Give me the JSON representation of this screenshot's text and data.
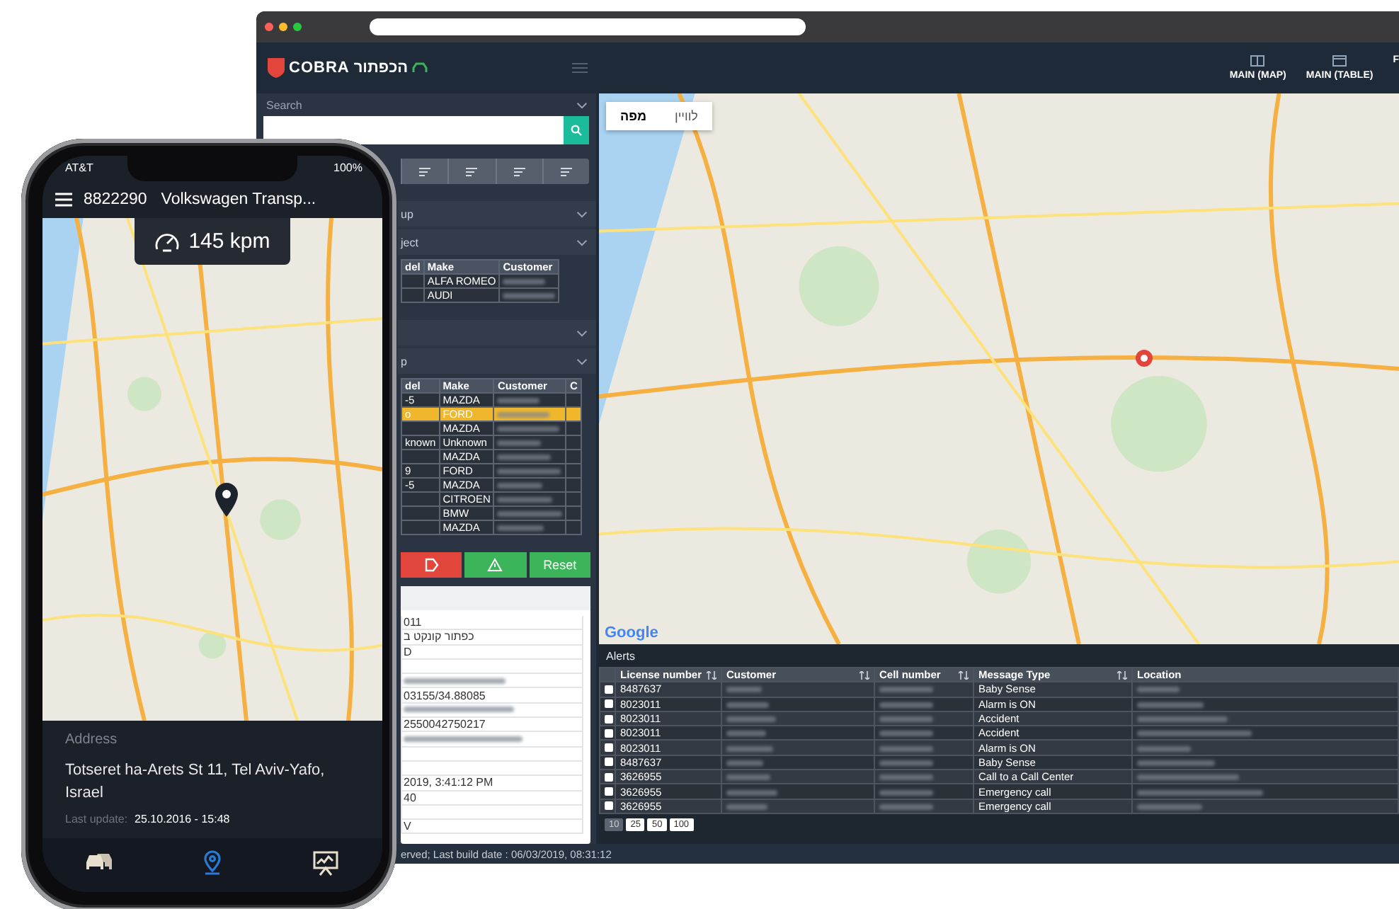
{
  "browser": {
    "logo": {
      "latin": "COBRA",
      "hebrew": "הכפתור"
    },
    "nav": [
      {
        "label": "MAIN (MAP)",
        "kind": "columns"
      },
      {
        "label": "MAIN (TABLE)",
        "kind": "window"
      },
      {
        "label": "F",
        "kind": "cut"
      }
    ],
    "sidebar": {
      "search_label": "Search",
      "sections": [
        {
          "kind": "group",
          "title": "up"
        },
        {
          "kind": "group",
          "title": "ject",
          "table": {
            "columns": [
              "del",
              "Make",
              "Customer"
            ],
            "rows": [
              {
                "make": "ALFA ROMEO",
                "selected": false
              },
              {
                "make": "AUDI",
                "selected": false
              }
            ]
          }
        },
        {
          "kind": "group"
        },
        {
          "kind": "group",
          "title": "p",
          "table": {
            "columns": [
              "del",
              "Make",
              "Customer",
              "C"
            ],
            "rows": [
              {
                "model": "-5",
                "make": "MAZDA",
                "selected": false
              },
              {
                "model": "o",
                "make": "FORD",
                "selected": true
              },
              {
                "make": "MAZDA",
                "selected": false
              },
              {
                "model": "known",
                "make": "Unknown",
                "selected": false
              },
              {
                "make": "MAZDA",
                "selected": false
              },
              {
                "model": "9",
                "make": "FORD",
                "selected": false
              },
              {
                "model": "-5",
                "make": "MAZDA",
                "selected": false
              },
              {
                "make": "CITROEN",
                "selected": false
              },
              {
                "make": "BMW",
                "selected": false
              },
              {
                "make": "MAZDA",
                "selected": false
              }
            ]
          }
        }
      ],
      "actions": [
        {
          "kind": "tag",
          "color": "#e2453c"
        },
        {
          "kind": "warning",
          "color": "#3cb55a"
        },
        {
          "kind": "text",
          "label": "Reset",
          "color": "#3cb55a"
        }
      ],
      "details": [
        {
          "kind": "text",
          "value": "011"
        },
        {
          "kind": "text",
          "value": "כפתור קונקט ב"
        },
        {
          "kind": "text",
          "value": "D"
        },
        {
          "kind": "empty"
        },
        {
          "kind": "blurred"
        },
        {
          "kind": "text",
          "value": "03155/34.88085"
        },
        {
          "kind": "blurred"
        },
        {
          "kind": "text",
          "value": "2550042750217"
        },
        {
          "kind": "blurred"
        },
        {
          "kind": "empty"
        },
        {
          "kind": "empty"
        },
        {
          "kind": "text",
          "value": "2019, 3:41:12 PM"
        },
        {
          "kind": "text",
          "value": "40"
        },
        {
          "kind": "empty"
        },
        {
          "kind": "text",
          "value": "V"
        }
      ]
    },
    "map": {
      "toggle": [
        {
          "label": "לוויין",
          "selected": false
        },
        {
          "label": "מפה",
          "selected": true
        }
      ],
      "logo": "Google"
    },
    "alerts": {
      "title": "Alerts",
      "columns": [
        {
          "label": "License number",
          "sortable": true
        },
        {
          "label": "Customer",
          "sortable": true
        },
        {
          "label": "Cell number",
          "sortable": true
        },
        {
          "label": "Message Type",
          "sortable": true
        },
        {
          "label": "Location",
          "sortable": false
        }
      ],
      "rows": [
        {
          "checked": false,
          "license_number": "8487637",
          "message_type": "Baby Sense"
        },
        {
          "checked": false,
          "license_number": "8023011",
          "message_type": "Alarm is ON"
        },
        {
          "checked": false,
          "license_number": "8023011",
          "message_type": "Accident"
        },
        {
          "checked": false,
          "license_number": "8023011",
          "message_type": "Accident"
        },
        {
          "checked": false,
          "license_number": "8023011",
          "message_type": "Alarm is ON"
        },
        {
          "checked": false,
          "license_number": "8487637",
          "message_type": "Baby Sense"
        },
        {
          "checked": false,
          "license_number": "3626955",
          "message_type": "Call to a Call Center"
        },
        {
          "checked": false,
          "license_number": "3626955",
          "message_type": "Emergency call"
        },
        {
          "checked": false,
          "license_number": "3626955",
          "message_type": "Emergency call"
        }
      ],
      "page_sizes": [
        {
          "label": "10",
          "selected": true
        },
        {
          "label": "25",
          "selected": false
        },
        {
          "label": "50",
          "selected": false
        },
        {
          "label": "100",
          "selected": false
        }
      ]
    },
    "footer": "erved; Last build date : 06/03/2019, 08:31:12"
  },
  "phone": {
    "carrier": "AT&T",
    "battery": "100%",
    "vehicle_id": "8822290",
    "vehicle_name": "Volkswagen Transp...",
    "speed": "145 kpm",
    "address_label": "Address",
    "address": "Totseret ha-Arets St 11, Tel Aviv-Yafo, Israel",
    "last_update_label": "Last update:",
    "last_update": "25.10.2016 - 15:48",
    "tabs": [
      {
        "kind": "car",
        "selected": false
      },
      {
        "kind": "pin",
        "selected": true
      },
      {
        "kind": "chart",
        "selected": false
      }
    ]
  }
}
